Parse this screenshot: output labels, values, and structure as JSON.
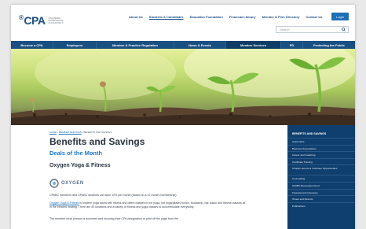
{
  "header": {
    "logo": "CPA",
    "logo_tagline": "CHARTERED PROFESSIONAL ACCOUNTANTS",
    "topnav": [
      "About Us",
      "Students & Candidates",
      "Education Foundation",
      "Financial Literacy",
      "Member & Firm Directory",
      "Contact Us"
    ],
    "login_label": "Login",
    "search_placeholder": "Search"
  },
  "mainnav": [
    "Become a CPA",
    "Employers",
    "Member & Practice Regulation",
    "News & Events",
    "Member Services",
    "PD",
    "Protecting the Public"
  ],
  "breadcrumb": [
    "HOME",
    "MEMBER SERVICES",
    "BENEFITS AND SAVINGS"
  ],
  "page": {
    "title": "Benefits and Savings",
    "subtitle": "Deals of the Month",
    "section_title": "Oxygen Yoga & Fitness",
    "oxygen_logo_text": "OXYGEN",
    "p1": "CPABC members and CPABC students can save 10% per month (based on a 12 month membership).",
    "p2_link": "Oxygen Yoga & Fitness",
    "p2_rest": " is modern yoga fused with fitness and offers classes in hot yoga, hot yoga/pilates fusion, bootcamp, bar fusion and fitness classes all in the infrared heating. There are 40 locations and a variety of fitness and yoga classes to accommodate everybody.",
    "p3": "The member must present a business card showing their CPA designation or print off the page from the"
  },
  "sidebar": {
    "heading": "BENEFITS AND SAVINGS",
    "items": [
      "Automotive",
      "Business Associations",
      "Career and Coaching",
      "Certificate Training",
      "Chapter Events & Volunteer Opportunities",
      "Counselling",
      "CPABC Benevolent Fund",
      "Financial and Insurance",
      "Hotels and Resorts",
      "Publications"
    ]
  },
  "colors": {
    "brand_blue": "#1d4e89",
    "nav_blue": "#1a4f82",
    "sidebar_blue": "#0f3f6e",
    "link_blue": "#1d6fb8",
    "subtitle_blue": "#1d7ad1"
  }
}
